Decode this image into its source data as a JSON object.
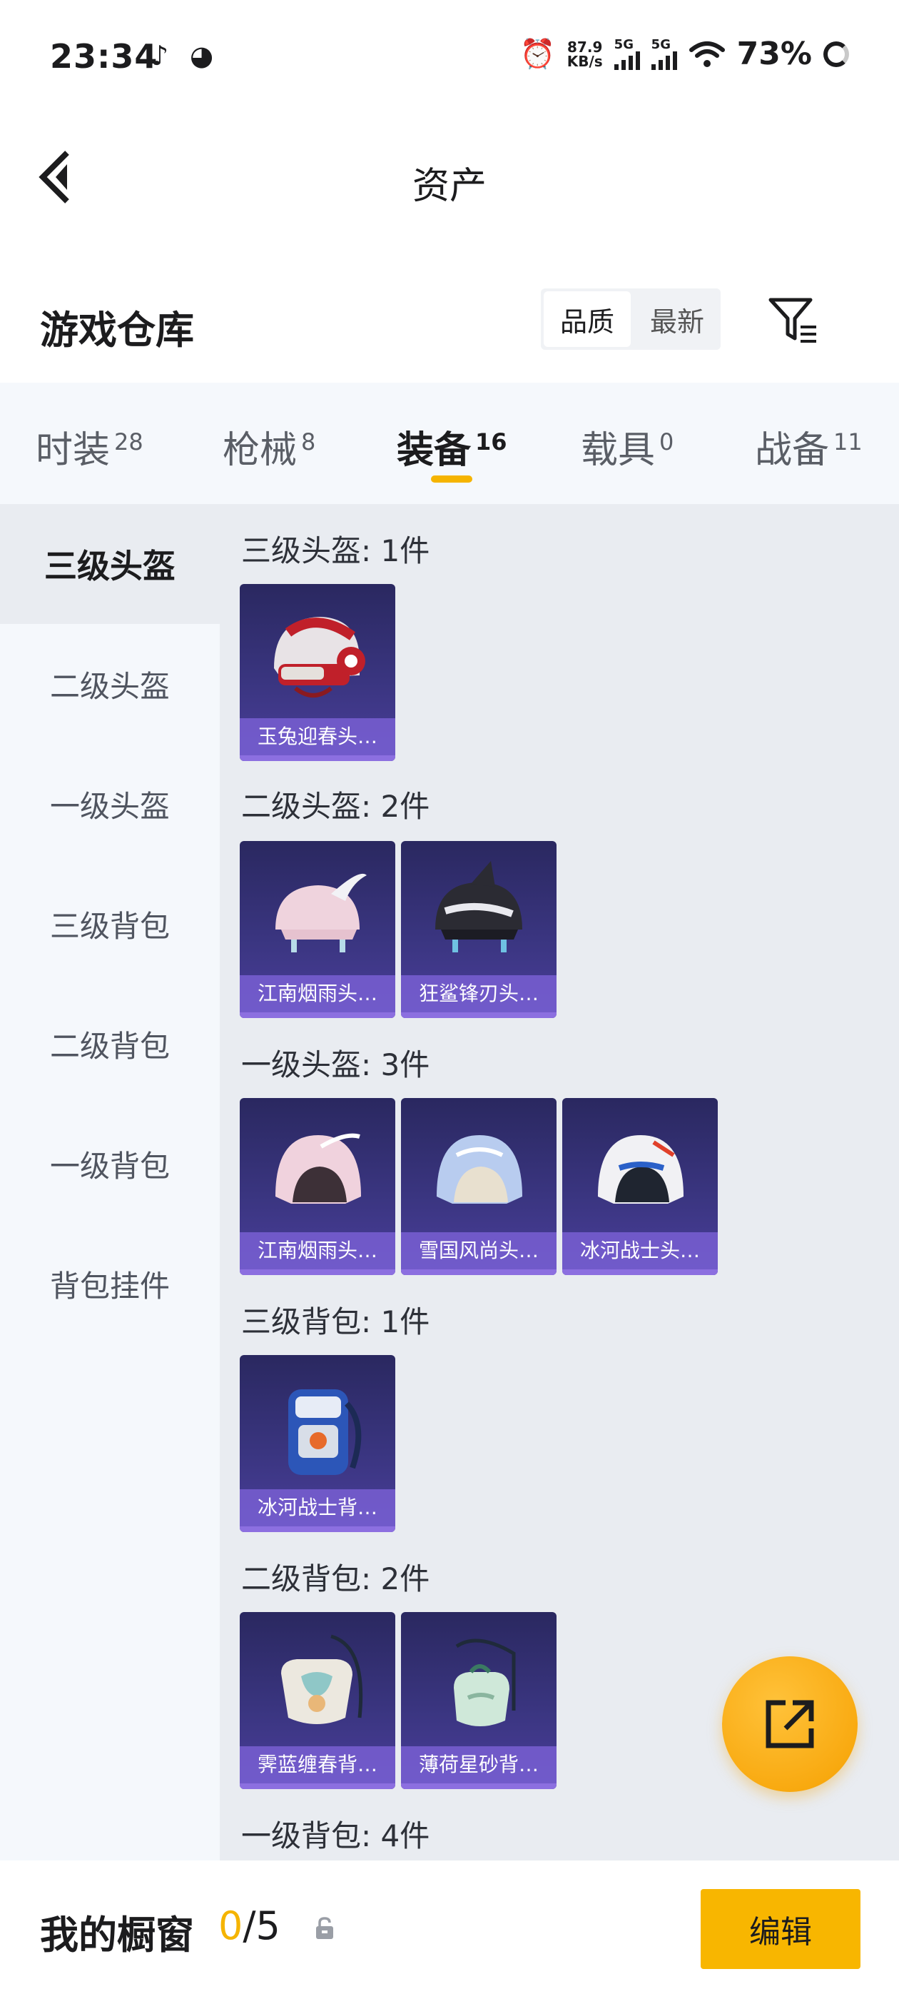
{
  "status_bar": {
    "time": "23:34",
    "app_icons": [
      "tiktok-icon",
      "weibo-icon"
    ],
    "net_speed_value": "87.9",
    "net_speed_unit": "KB/s",
    "signal1_label": "5G",
    "signal2_label": "5G",
    "battery": "73%"
  },
  "header": {
    "title": "资产"
  },
  "section": {
    "title": "游戏仓库",
    "sort_options": [
      "品质",
      "最新"
    ],
    "sort_selected": "品质"
  },
  "tabs": [
    {
      "label": "时装",
      "count": "28"
    },
    {
      "label": "枪械",
      "count": "8"
    },
    {
      "label": "装备",
      "count": "16",
      "active": true
    },
    {
      "label": "载具",
      "count": "0"
    },
    {
      "label": "战备",
      "count": "11"
    }
  ],
  "sidebar": {
    "items": [
      {
        "label": "三级头盔",
        "active": true
      },
      {
        "label": "二级头盔"
      },
      {
        "label": "一级头盔"
      },
      {
        "label": "三级背包"
      },
      {
        "label": "二级背包"
      },
      {
        "label": "一级背包"
      },
      {
        "label": "背包挂件"
      }
    ]
  },
  "groups": [
    {
      "label": "三级头盔: 1件",
      "items": [
        {
          "name": "玉兔迎春头…",
          "art": "helmet-red"
        }
      ]
    },
    {
      "label": "二级头盔: 2件",
      "items": [
        {
          "name": "江南烟雨头…",
          "art": "helmet-pink-wing"
        },
        {
          "name": "狂鲨锋刃头…",
          "art": "helmet-shark"
        }
      ]
    },
    {
      "label": "一级头盔: 3件",
      "items": [
        {
          "name": "江南烟雨头…",
          "art": "helmet-pink"
        },
        {
          "name": "雪国风尚头…",
          "art": "helmet-blue"
        },
        {
          "name": "冰河战士头…",
          "art": "helmet-white"
        }
      ]
    },
    {
      "label": "三级背包: 1件",
      "items": [
        {
          "name": "冰河战士背…",
          "art": "backpack-blue"
        }
      ]
    },
    {
      "label": "二级背包: 2件",
      "items": [
        {
          "name": "霁蓝缠春背…",
          "art": "backpack-white"
        },
        {
          "name": "薄荷星砂背…",
          "art": "backpack-mint"
        }
      ]
    },
    {
      "label": "一级背包: 4件",
      "items": []
    }
  ],
  "bottom_bar": {
    "label": "我的橱窗",
    "current": "0",
    "separator_total": "/5",
    "edit_label": "编辑"
  },
  "colors": {
    "accent": "#f5b400",
    "card_bg": "#34306f",
    "card_name_bg": "#7a5fd2"
  }
}
